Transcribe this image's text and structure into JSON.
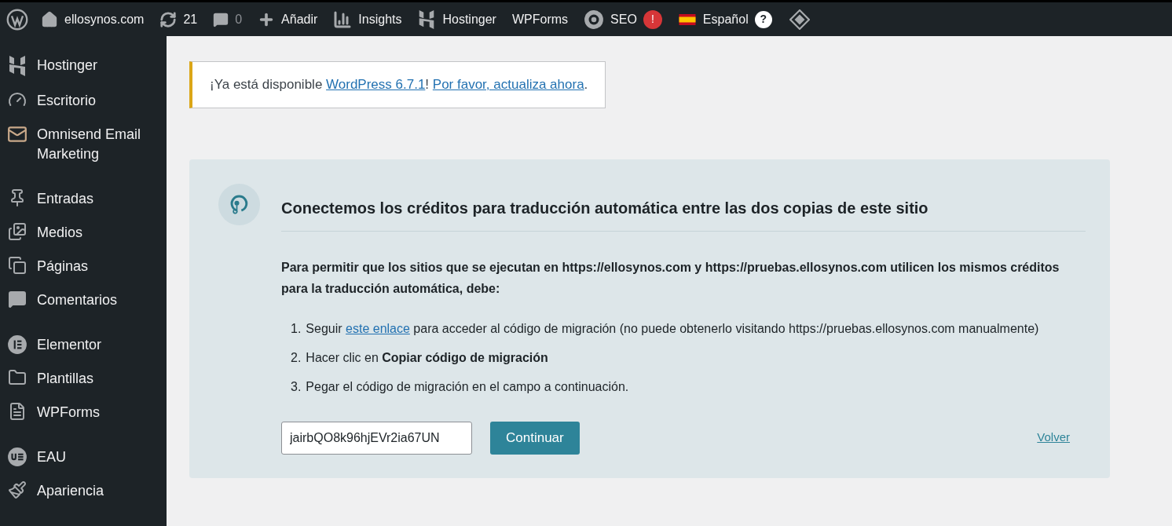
{
  "admin_bar": {
    "site": "ellosynos.com",
    "updates": "21",
    "comments": {
      "count": "0",
      "disabled": true
    },
    "add": "Añadir",
    "insights": "Insights",
    "hostinger": "Hostinger",
    "wpforms": "WPForms",
    "seo": {
      "label": "SEO",
      "badge": "!"
    },
    "language": {
      "label": "Español",
      "help": "?"
    }
  },
  "sidebar": {
    "groups": [
      [
        {
          "label": "Hostinger"
        },
        {
          "label": "Escritorio"
        },
        {
          "label": "Omnisend Email Marketing"
        }
      ],
      [
        {
          "label": "Entradas"
        },
        {
          "label": "Medios"
        },
        {
          "label": "Páginas"
        },
        {
          "label": "Comentarios"
        }
      ],
      [
        {
          "label": "Elementor"
        },
        {
          "label": "Plantillas"
        },
        {
          "label": "WPForms"
        }
      ],
      [
        {
          "label": "EAU"
        },
        {
          "label": "Apariencia"
        }
      ]
    ]
  },
  "notice": {
    "parts": [
      {
        "kind": "text",
        "text": "¡Ya está disponible "
      },
      {
        "kind": "link",
        "text": "WordPress 6.7.1"
      },
      {
        "kind": "text",
        "text": "! "
      },
      {
        "kind": "link",
        "text": "Por favor, actualiza ahora"
      },
      {
        "kind": "text",
        "text": "."
      }
    ]
  },
  "card": {
    "title": "Conectemos los créditos para traducción automática entre las dos copias de este sitio",
    "intro": "Para permitir que los sitios que se ejecutan en https://ellosynos.com y https://pruebas.ellosynos.com utilicen los mismos créditos para la traducción automática, debe:",
    "steps": [
      {
        "number": "1.",
        "parts": [
          {
            "kind": "text",
            "text": "Seguir "
          },
          {
            "kind": "link",
            "text": "este enlace"
          },
          {
            "kind": "text",
            "text": " para acceder al código de migración (no puede obtenerlo visitando https://pruebas.ellosynos.com manualmente)"
          }
        ]
      },
      {
        "number": "2.",
        "parts": [
          {
            "kind": "text",
            "text": "Hacer clic en **Copiar código de migración**"
          }
        ]
      },
      {
        "number": "3.",
        "parts": [
          {
            "kind": "text",
            "text": "Pegar el código de migración en el campo a continuación."
          }
        ]
      }
    ],
    "code_field": {
      "value": "jairbQO8k96hjEVr2ia67UN"
    },
    "continue_button": "Continuar",
    "back_link": "Volver"
  }
}
